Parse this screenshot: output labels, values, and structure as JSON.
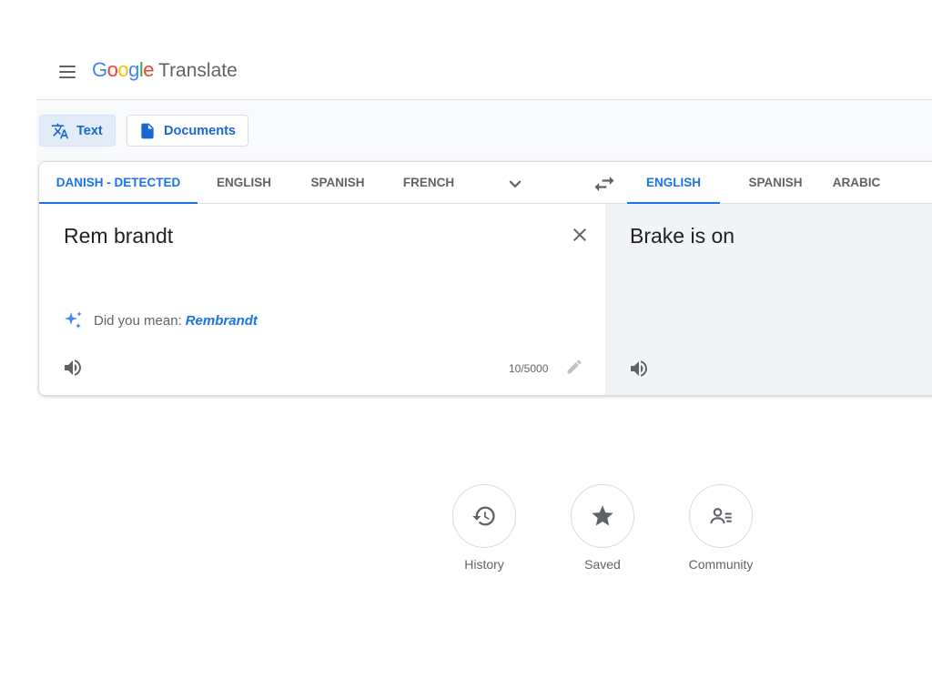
{
  "app": {
    "logo_word": [
      "G",
      "o",
      "o",
      "g",
      "l",
      "e"
    ],
    "logo_colors": [
      "#4285f4",
      "#ea4335",
      "#fbbc05",
      "#4285f4",
      "#34a853",
      "#ea4335"
    ],
    "product_name": "Translate"
  },
  "modes": [
    {
      "label": "Text",
      "icon": "translate-icon",
      "active": true
    },
    {
      "label": "Documents",
      "icon": "document-icon",
      "active": false
    }
  ],
  "source_languages": [
    {
      "label": "DANISH - DETECTED",
      "active": true
    },
    {
      "label": "ENGLISH",
      "active": false
    },
    {
      "label": "SPANISH",
      "active": false
    },
    {
      "label": "FRENCH",
      "active": false
    }
  ],
  "target_languages": [
    {
      "label": "ENGLISH",
      "active": true
    },
    {
      "label": "SPANISH",
      "active": false
    },
    {
      "label": "ARABIC",
      "active": false
    }
  ],
  "source": {
    "text": "Rem brandt",
    "suggestion_prefix": "Did you mean:",
    "suggestion": "Rembrandt",
    "char_count": "10/5000"
  },
  "target": {
    "text": "Brake is on"
  },
  "actions": [
    {
      "label": "History",
      "icon": "history-icon"
    },
    {
      "label": "Saved",
      "icon": "star-icon"
    },
    {
      "label": "Community",
      "icon": "community-icon"
    }
  ],
  "colors": {
    "accent": "#1a73e8",
    "text_mode_bg": "#e2ebf8",
    "target_panel_bg": "#f1f3f4",
    "icon_gray": "#5f6368"
  }
}
